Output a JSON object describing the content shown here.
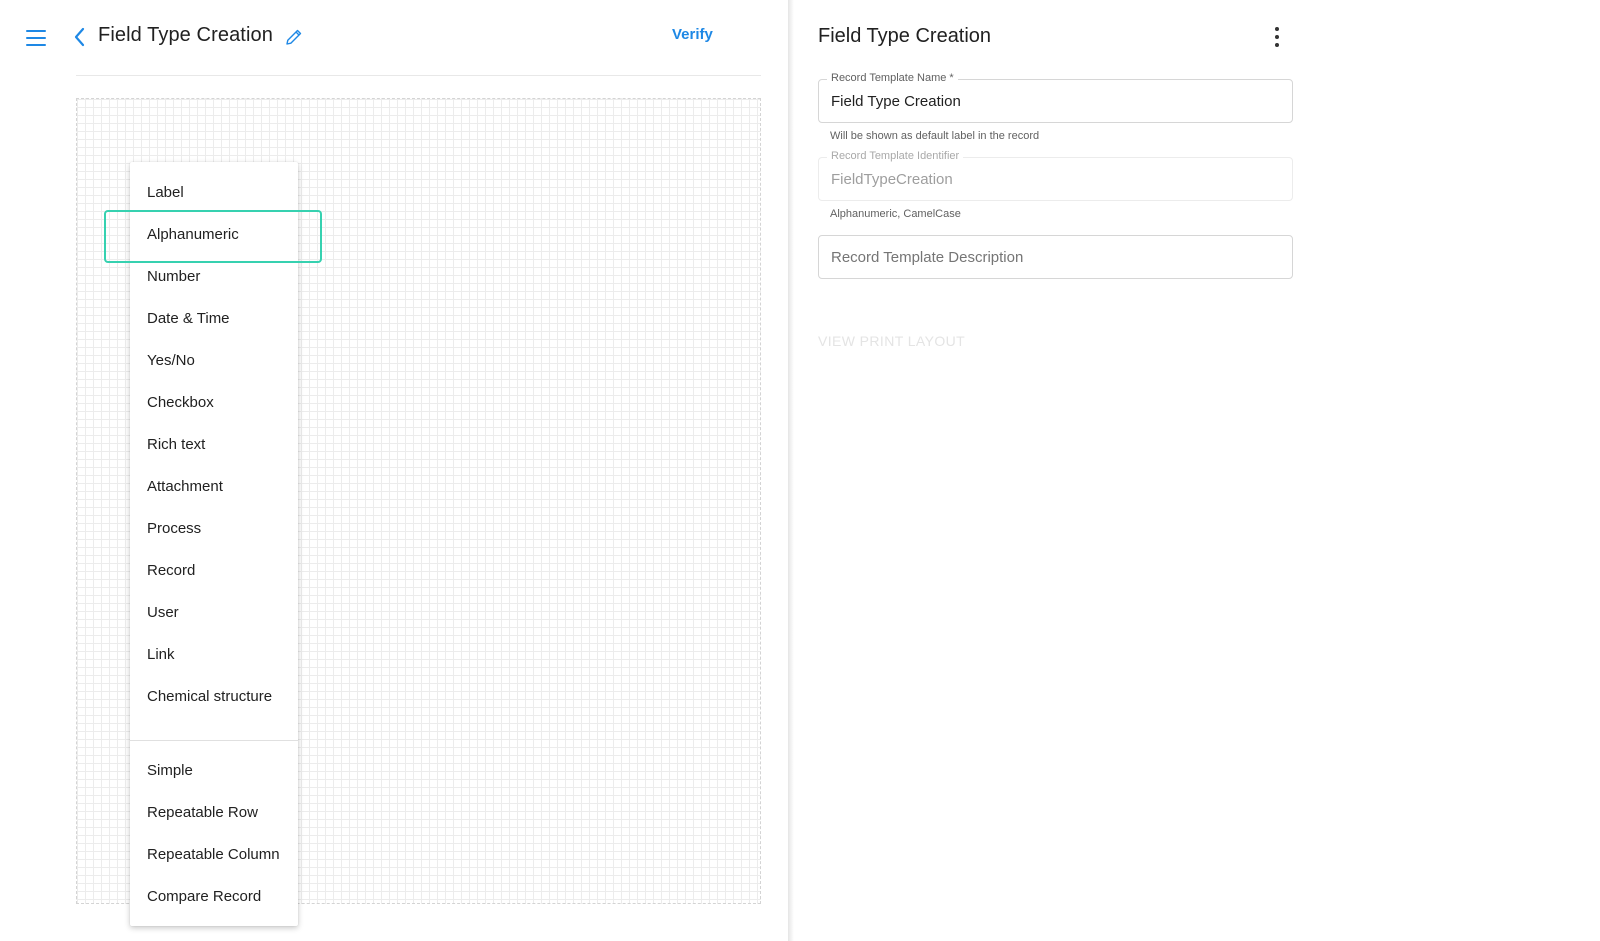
{
  "header": {
    "title": "Field Type Creation",
    "verify_label": "Verify"
  },
  "icons": {
    "menu": "hamburger-menu-icon",
    "back": "chevron-left-icon",
    "edit": "pencil-icon",
    "more": "more-vertical-icon"
  },
  "colors": {
    "accent": "#1e88e5",
    "highlight": "#36d1b0"
  },
  "field_type_menu": {
    "items": [
      "Label",
      "Alphanumeric",
      "Number",
      "Date & Time",
      "Yes/No",
      "Checkbox",
      "Rich text",
      "Attachment",
      "Process",
      "Record",
      "User",
      "Link",
      "Chemical structure"
    ],
    "layout_items": [
      "Simple",
      "Repeatable Row",
      "Repeatable Column",
      "Compare Record"
    ],
    "highlighted": "Alphanumeric"
  },
  "panel": {
    "title": "Field Type Creation",
    "name_field": {
      "label": "Record Template Name *",
      "value": "Field Type Creation",
      "helper": "Will be shown as default label in the record"
    },
    "identifier_field": {
      "label": "Record Template Identifier",
      "value": "FieldTypeCreation",
      "helper": "Alphanumeric, CamelCase"
    },
    "description_field": {
      "placeholder": "Record Template Description",
      "value": ""
    },
    "print_layout_label": "VIEW PRINT LAYOUT"
  }
}
